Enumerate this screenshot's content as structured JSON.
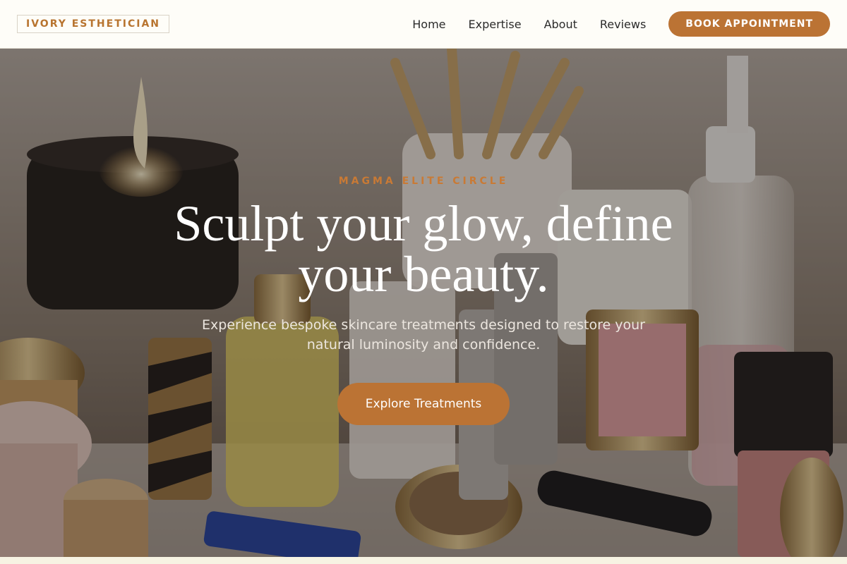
{
  "brand": {
    "name": "IVORY ESTHETICIAN"
  },
  "nav": {
    "items": [
      {
        "label": "Home"
      },
      {
        "label": "Expertise"
      },
      {
        "label": "About"
      },
      {
        "label": "Reviews"
      }
    ],
    "cta_label": "BOOK APPOINTMENT"
  },
  "hero": {
    "eyebrow": "MAGMA ELITE CIRCLE",
    "headline": "Sculpt your glow, define your beauty.",
    "subtext": "Experience bespoke skincare treatments designed to restore your natural luminosity and confidence.",
    "cta_label": "Explore Treatments",
    "background_image": "cosmetics-vanity-photo"
  },
  "colors": {
    "accent": "#bb7334",
    "header_bg": "#fefdf8",
    "text_dark": "#2b2b2b"
  }
}
